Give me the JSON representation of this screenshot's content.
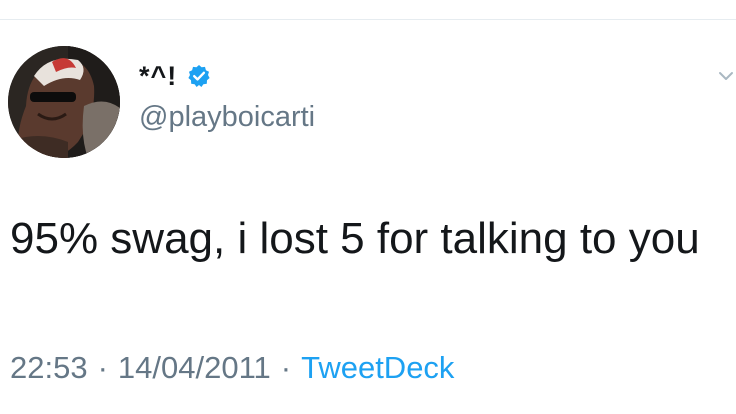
{
  "user": {
    "display_name": "*^!",
    "handle": "@playboicarti",
    "verified_icon": "verified-badge-icon"
  },
  "tweet": {
    "text": "95% swag, i lost 5 for talking to you",
    "time": "22:53",
    "date": "14/04/2011",
    "separator": "·",
    "source": "TweetDeck"
  },
  "icons": {
    "more": "chevron-down-icon"
  },
  "colors": {
    "text": "#14171a",
    "secondary": "#657786",
    "link": "#1da1f2",
    "verified": "#1da1f2"
  }
}
